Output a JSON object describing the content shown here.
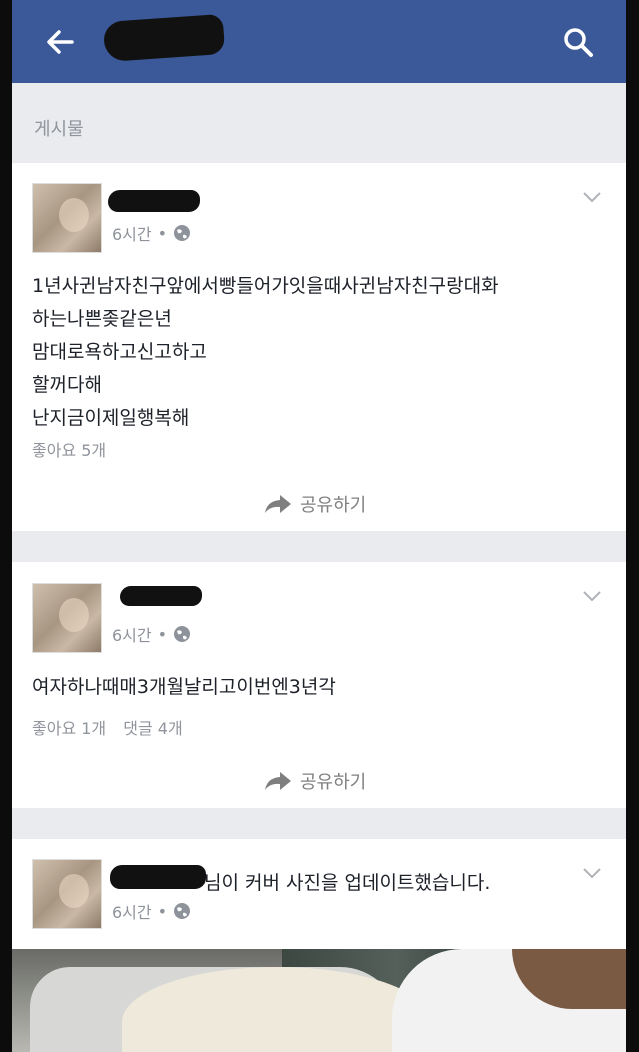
{
  "section": {
    "title": "게시물"
  },
  "posts": [
    {
      "time": "6시간",
      "separator": "•",
      "lines": [
        "1년사귄남자친구앞에서빵들어가잇을때사귄남자친구랑대화",
        "하는나쁜좆같은년",
        "맘대로욕하고신고하고",
        "할꺼다해",
        "난지금이제일행복해"
      ],
      "likes": "좋아요 5개",
      "share_label": "공유하기"
    },
    {
      "time": "6시간",
      "separator": "•",
      "lines": [
        "여자하나때매3개월날리고이번엔3년각"
      ],
      "likes": "좋아요 1개",
      "comments": "댓글 4개",
      "share_label": "공유하기"
    },
    {
      "time": "6시간",
      "separator": "•",
      "text": "님이 커버 사진을 업데이트했습니다."
    }
  ],
  "icons": {
    "back": "back-arrow-icon",
    "search": "search-icon",
    "globe": "globe-icon",
    "chevron": "chevron-down-icon",
    "share": "share-arrow-icon"
  },
  "colors": {
    "header": "#3b5998",
    "background": "#e9ebee",
    "card": "#ffffff"
  }
}
